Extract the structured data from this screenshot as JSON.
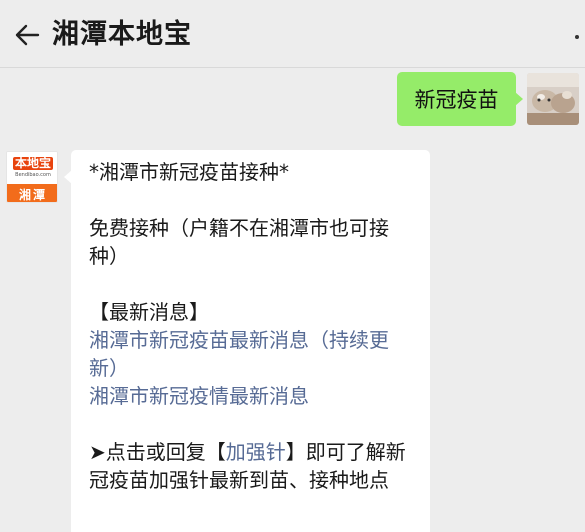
{
  "header": {
    "title": "湘潭本地宝"
  },
  "messages": {
    "outgoing": {
      "text": "新冠疫苗"
    },
    "incoming": {
      "bot_logo_main": "本地宝",
      "bot_logo_sub": "Bendibao.com",
      "bot_logo_city": "湘潭",
      "line1": "*湘潭市新冠疫苗接种*",
      "line2": "免费接种（户籍不在湘潭市也可接种）",
      "line3": "【最新消息】",
      "link1": "湘潭市新冠疫苗最新消息（持续更新）",
      "link2": "湘潭市新冠疫情最新消息",
      "line4_prefix": "➤点击或回复【",
      "line4_link": "加强针",
      "line4_suffix": "】即可了解新冠疫苗加强针最新到苗、接种地点"
    }
  },
  "colors": {
    "background": "#ededed",
    "outgoing_bubble": "#95ec69",
    "incoming_bubble": "#ffffff",
    "link": "#576b95",
    "brand_orange": "#f26c1b"
  }
}
